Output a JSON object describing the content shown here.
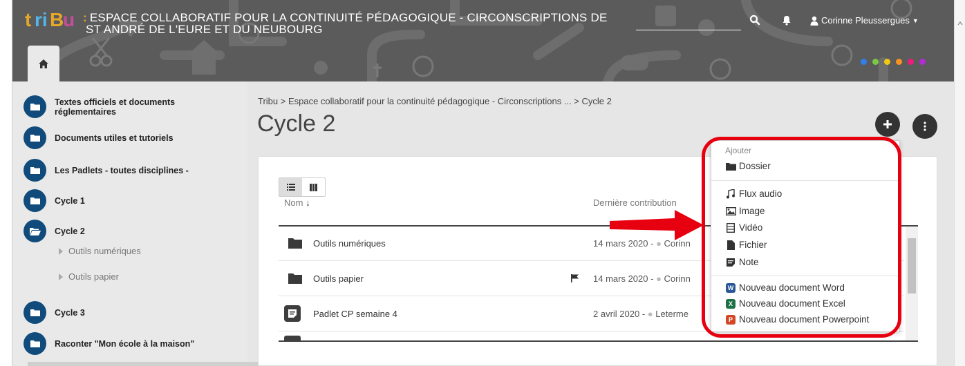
{
  "header": {
    "logo_text": "triBu",
    "title_line1": "ESPACE COLLABORATIF POUR LA CONTINUITÉ PÉDAGOGIQUE - CIRCONSCRIPTIONS DE",
    "title_line2": "ST ANDRÉ DE L'EURE ET DU NEUBOURG",
    "user_name": "Corinne Pleussergues",
    "dot_colors": [
      "#2f80ed",
      "#7ac943",
      "#f2c811",
      "#f7931e",
      "#ec1c78",
      "#b22cd3"
    ]
  },
  "sidebar": {
    "items": [
      {
        "line1": "Textes officiels et documents",
        "line2": "réglementaires"
      },
      {
        "label": "Documents utiles et tutoriels"
      },
      {
        "label": "Les Padlets - toutes disciplines -"
      },
      {
        "label": "Cycle 1"
      },
      {
        "label": "Cycle 2"
      },
      {
        "label": "Cycle 3"
      },
      {
        "label": "Raconter \"Mon école à la maison\""
      }
    ],
    "subitems": [
      "Outils numériques",
      "Outils papier"
    ]
  },
  "main": {
    "breadcrumb": "Tribu > Espace collaboratif pour la continuité pédagogique - Circonscriptions ... > Cycle 2",
    "title": "Cycle 2",
    "col_name": "Nom",
    "col_contrib": "Dernière contribution",
    "rows": [
      {
        "name": "Outils numériques",
        "date": "14 mars 2020 -",
        "author": "Corinn"
      },
      {
        "name": "Outils papier",
        "date": "14 mars 2020 -",
        "author": "Corinn"
      },
      {
        "name": "Padlet CP semaine 4",
        "date": "2 avril 2020 -",
        "author": "Leterme"
      }
    ]
  },
  "add_menu": {
    "header": "Ajouter",
    "folder": "Dossier",
    "audio": "Flux audio",
    "image": "Image",
    "video": "Vidéo",
    "file": "Fichier",
    "note": "Note",
    "word": "Nouveau document Word",
    "excel": "Nouveau document Excel",
    "powerpoint": "Nouveau document Powerpoint"
  },
  "colors": {
    "header_bg": "#5b5b5b",
    "sidebar_circle": "#104b7b",
    "highlight": "#e7000f",
    "word": "#2b5797",
    "excel": "#1e7145",
    "powerpoint": "#d24726"
  }
}
